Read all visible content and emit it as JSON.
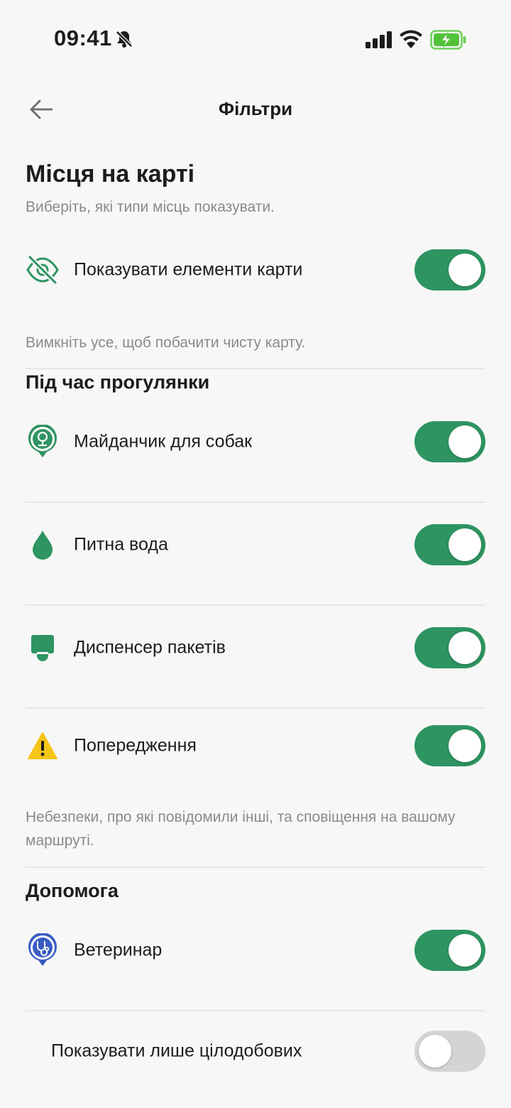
{
  "status_bar": {
    "time": "09:41",
    "icons": [
      "bell-slash-icon",
      "cellular-signal-icon",
      "wifi-icon",
      "battery-charging-icon"
    ]
  },
  "header": {
    "title": "Фільтри",
    "back_icon": "arrow-left-icon"
  },
  "section": {
    "title": "Місця на карті",
    "subtitle": "Виберіть, які типи місць показувати."
  },
  "map_elements": {
    "label": "Показувати елементи карти",
    "icon": "eye-slash-icon",
    "enabled": true,
    "note": "Вимкніть усе, щоб побачити чисту карту."
  },
  "walk": {
    "title": "Під час прогулянки",
    "items": [
      {
        "label": "Майданчик для собак",
        "icon": "dog-park-pin-icon",
        "enabled": true
      },
      {
        "label": "Питна вода",
        "icon": "water-drop-icon",
        "enabled": true
      },
      {
        "label": "Диспенсер пакетів",
        "icon": "bag-dispenser-icon",
        "enabled": true
      },
      {
        "label": "Попередження",
        "icon": "warning-icon",
        "enabled": true
      }
    ],
    "note": "Небезпеки, про які повідомили інші, та сповіщення на вашому маршруті."
  },
  "help": {
    "title": "Допомога",
    "items": [
      {
        "label": "Ветеринар",
        "icon": "vet-stethoscope-pin-icon",
        "enabled": true
      },
      {
        "label": "Показувати лише цілодобових",
        "enabled": false
      }
    ]
  },
  "colors": {
    "accent": "#2e9461",
    "toggle_off": "#d4d4d6",
    "vet_blue": "#3b5cc4",
    "warning": "#f5c518"
  }
}
